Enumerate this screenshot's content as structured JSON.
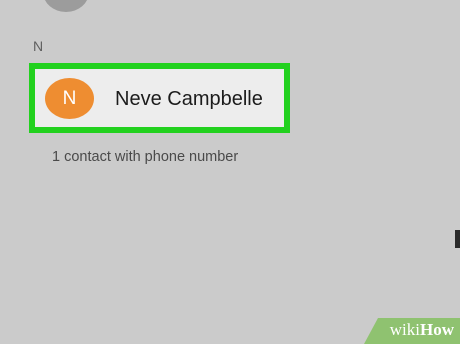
{
  "previous_contact": {
    "avatar_color": "#9c9c9c"
  },
  "section": {
    "letter": "N"
  },
  "contact": {
    "initial": "N",
    "name": "Neve Campbelle",
    "subtitle": "1 contact with phone number",
    "avatar_color": "#ee8d31",
    "highlight_color": "#22d11e"
  },
  "watermark": {
    "wiki": "wiki",
    "how": "How"
  }
}
